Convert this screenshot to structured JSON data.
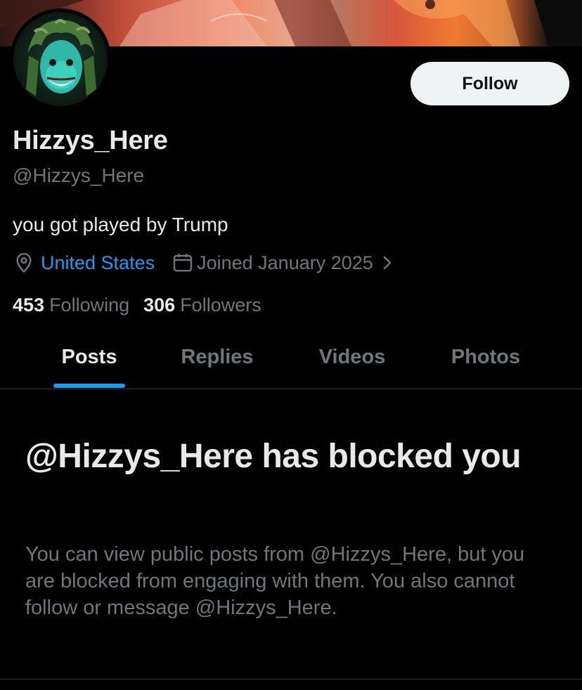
{
  "profile": {
    "display_name": "Hizzys_Here",
    "handle": "@Hizzys_Here",
    "bio": "you got played by Trump",
    "location": "United States",
    "joined": "Joined January 2025",
    "follow_label": "Follow"
  },
  "stats": {
    "following_count": "453",
    "following_label": "Following",
    "followers_count": "306",
    "followers_label": "Followers"
  },
  "tabs": [
    {
      "label": "Posts",
      "active": true
    },
    {
      "label": "Replies",
      "active": false
    },
    {
      "label": "Videos",
      "active": false
    },
    {
      "label": "Photos",
      "active": false
    }
  ],
  "blocked": {
    "title": "@Hizzys_Here has blocked you",
    "description": "You can view public posts from @Hizzys_Here, but you are blocked from engaging with them. You also cannot follow or message @Hizzys_Here."
  },
  "icons": {
    "location": "location-pin-icon",
    "calendar": "calendar-icon",
    "chevron": "chevron-right-icon"
  },
  "colors": {
    "background": "#000000",
    "accent": "#1d9bf0",
    "primary_text": "#e7e9ea",
    "secondary_text": "#71767b",
    "button_bg": "#eff3f4"
  }
}
